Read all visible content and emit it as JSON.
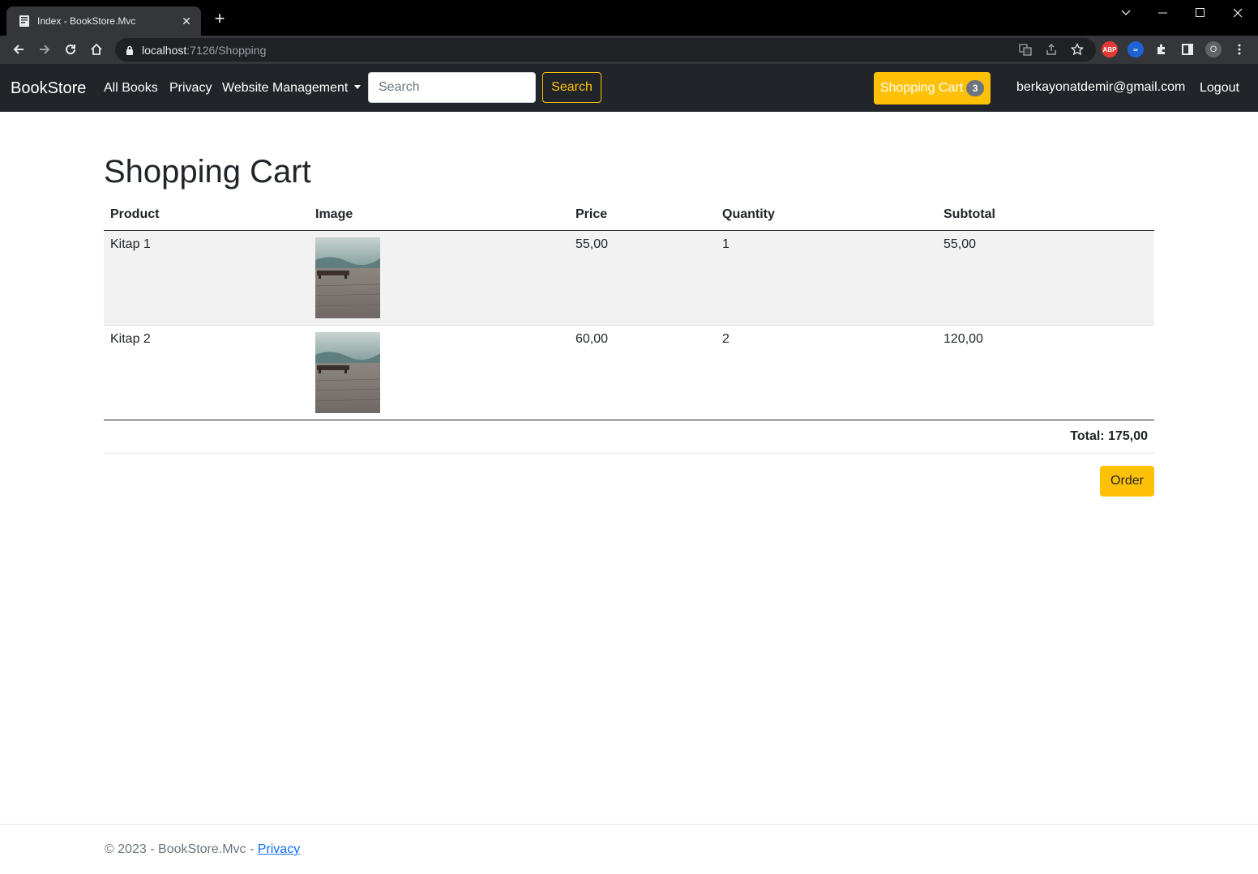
{
  "browser": {
    "tab_title": "Index - BookStore.Mvc",
    "url_host": "localhost",
    "url_path": ":7126/Shopping",
    "profile_initial": "O"
  },
  "navbar": {
    "brand": "BookStore",
    "links": [
      "All Books",
      "Privacy",
      "Website Management"
    ],
    "search_placeholder": "Search",
    "search_button": "Search",
    "cart_label": "Shopping Cart",
    "cart_count": "3",
    "user_email": "berkayonatdemir@gmail.com",
    "logout": "Logout"
  },
  "cart": {
    "title": "Shopping Cart",
    "columns": [
      "Product",
      "Image",
      "Price",
      "Quantity",
      "Subtotal"
    ],
    "rows": [
      {
        "product": "Kitap 1",
        "price": "55,00",
        "quantity": "1",
        "subtotal": "55,00"
      },
      {
        "product": "Kitap 2",
        "price": "60,00",
        "quantity": "2",
        "subtotal": "120,00"
      }
    ],
    "total": "Total: 175,00",
    "order_button": "Order"
  },
  "footer": {
    "text": "© 2023 - BookStore.Mvc - ",
    "privacy_link": "Privacy"
  },
  "colors": {
    "navbar_bg": "#212529",
    "accent": "#ffc107",
    "badge": "#6c757d",
    "link": "#0d6efd"
  }
}
